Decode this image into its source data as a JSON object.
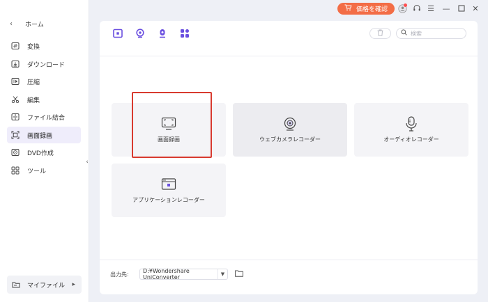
{
  "sidebar": {
    "home_label": "ホーム",
    "items": [
      {
        "label": "変換",
        "icon": "convert-icon"
      },
      {
        "label": "ダウンロード",
        "icon": "download-icon"
      },
      {
        "label": "圧縮",
        "icon": "compress-icon"
      },
      {
        "label": "編集",
        "icon": "edit-scissors-icon"
      },
      {
        "label": "ファイル結合",
        "icon": "merge-icon"
      },
      {
        "label": "画面録画",
        "icon": "screen-record-icon",
        "active": true
      },
      {
        "label": "DVD作成",
        "icon": "dvd-icon"
      },
      {
        "label": "ツール",
        "icon": "toolbox-icon"
      }
    ],
    "myfile_label": "マイファイル"
  },
  "titlebar": {
    "price_label": "価格を確認"
  },
  "search": {
    "placeholder": "検索"
  },
  "cards": [
    {
      "label": "画面録画",
      "icon": "screen-capture-icon"
    },
    {
      "label": "ウェブカメラレコーダー",
      "icon": "webcam-icon"
    },
    {
      "label": "オーディオレコーダー",
      "icon": "microphone-icon"
    },
    {
      "label": "アプリケーションレコーダー",
      "icon": "app-window-icon"
    }
  ],
  "output": {
    "label": "出力先:",
    "path": "D:¥Wondershare UniConverter"
  },
  "colors": {
    "accent": "#6a4fe0",
    "price_button": "#f36d46",
    "highlight_border": "#d83a2f",
    "active_nav_bg": "#efedfb"
  }
}
